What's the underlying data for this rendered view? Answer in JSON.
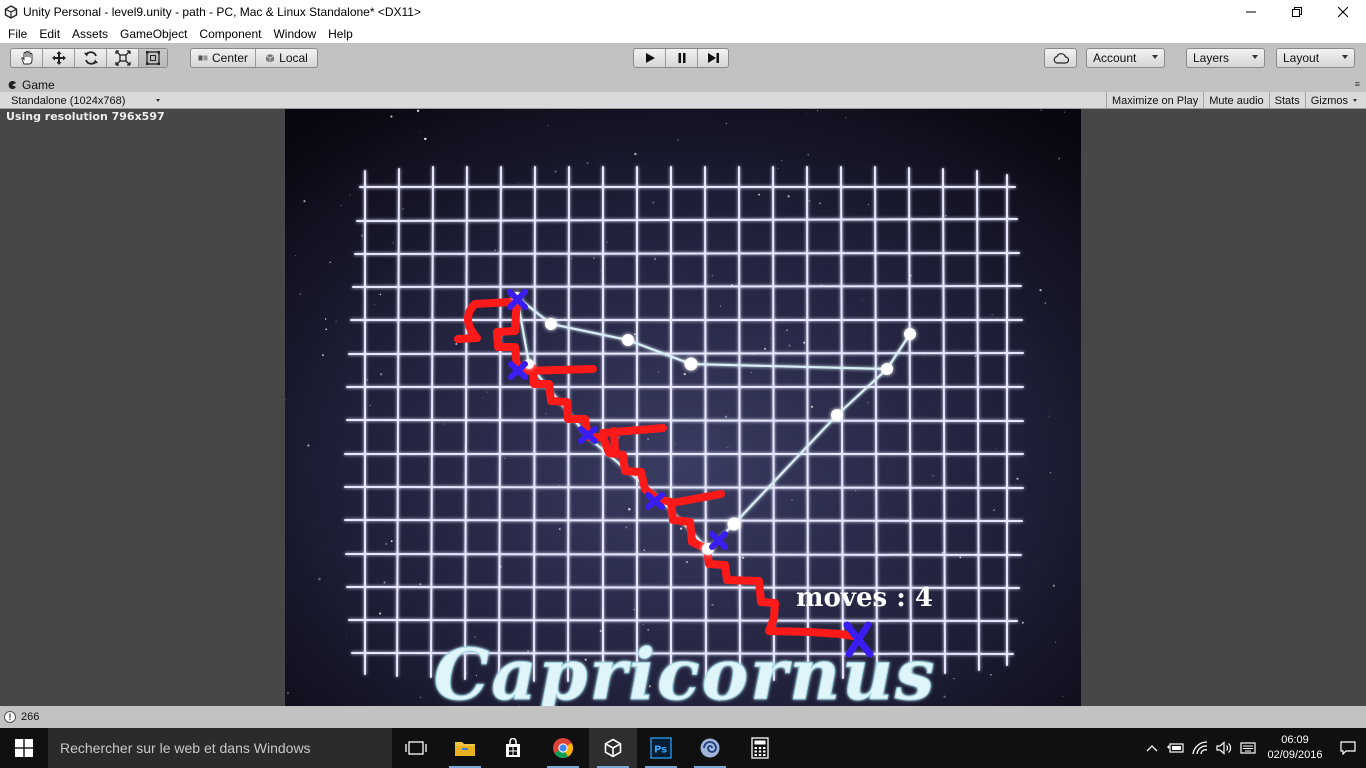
{
  "window": {
    "title": "Unity Personal - level9.unity - path - PC, Mac & Linux Standalone* <DX11>"
  },
  "menu": [
    "File",
    "Edit",
    "Assets",
    "GameObject",
    "Component",
    "Window",
    "Help"
  ],
  "toolbar": {
    "transform_tools": [
      "hand-tool",
      "move-tool",
      "rotate-tool",
      "scale-tool",
      "rect-tool"
    ],
    "pivot_center_label": "Center",
    "pivot_local_label": "Local",
    "playback": [
      "play",
      "pause",
      "step"
    ],
    "account_label": "Account",
    "layers_label": "Layers",
    "layout_label": "Layout"
  },
  "game_panel": {
    "tab_label": "Game",
    "aspect_label": "Standalone (1024x768)",
    "toggles": {
      "maximize": "Maximize on Play",
      "mute": "Mute audio",
      "stats": "Stats",
      "gizmos": "Gizmos"
    },
    "resolution_info": "Using resolution 796x597"
  },
  "game": {
    "moves_text": "moves : 4",
    "constellation_title": "Capricornus"
  },
  "status": {
    "warning_count": "266"
  },
  "taskbar": {
    "search_placeholder": "Rechercher sur le web et dans Windows",
    "apps": [
      "task-view",
      "file-explorer",
      "store",
      "chrome",
      "unity",
      "photoshop",
      "app-7",
      "calculator"
    ],
    "time": "06:09",
    "date": "02/09/2016"
  },
  "colors": {
    "path_red": "#ff1a1a",
    "marker_blue": "#3a1df0",
    "grid_line": "#e6e6ff",
    "constellation_line": "#d8eef5",
    "editor_gray": "#c2c2c2"
  }
}
